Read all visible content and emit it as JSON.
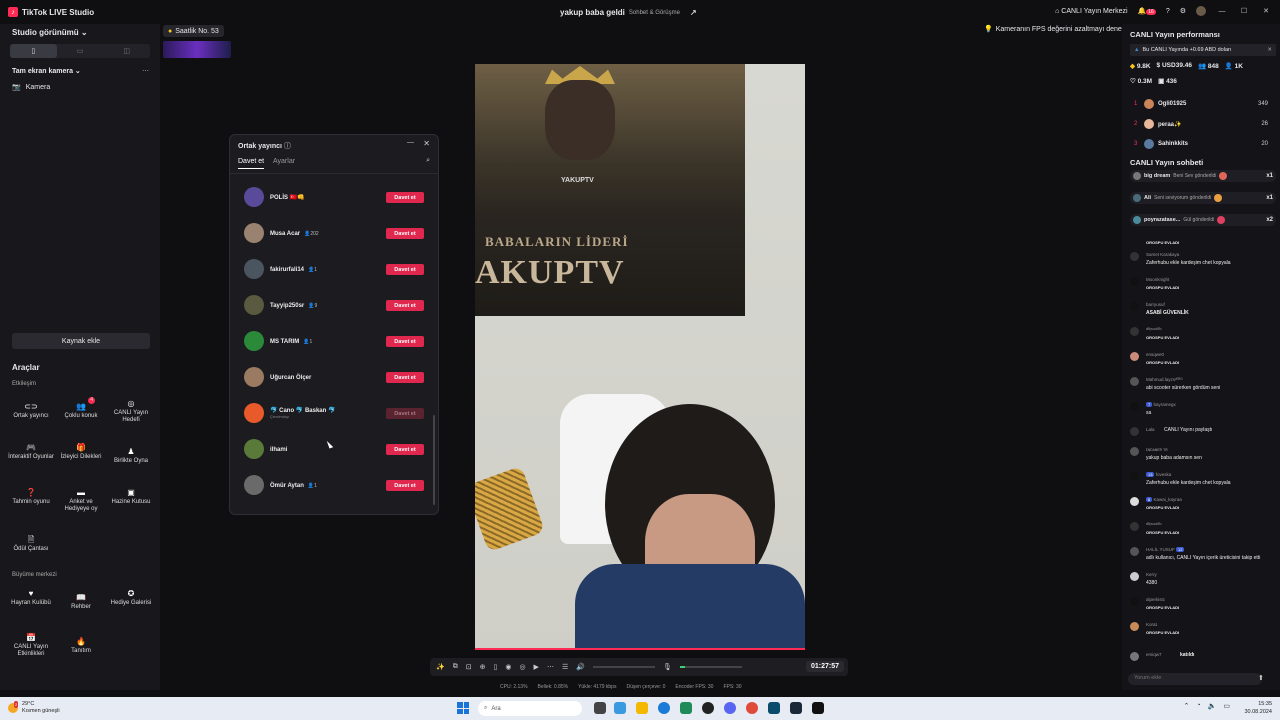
{
  "titlebar": {
    "app_name": "TikTok LIVE Studio",
    "stream_title": "yakup baba geldi",
    "category": "Sohbet & Görüşme",
    "live_center": "CANLI Yayın Merkezi",
    "notif_count": "16"
  },
  "left": {
    "studio_view": "Studio görünümü",
    "scene_name": "Tam ekran kamera",
    "source_camera": "Kamera",
    "add_source": "Kaynak ekle",
    "tools_title": "Araçlar",
    "engagement": "Etkileşim",
    "growth": "Büyüme merkezi",
    "tools": [
      {
        "label": "Ortak yayıncı",
        "icon": "co-host-icon"
      },
      {
        "label": "Çoklu konuk",
        "icon": "multi-guest-icon",
        "badge": "4"
      },
      {
        "label": "CANLI Yayın Hedefi",
        "icon": "live-goal-icon"
      },
      {
        "label": "İnteraktif Oyunlar",
        "icon": "games-icon"
      },
      {
        "label": "İzleyici Dilekleri",
        "icon": "wishes-icon"
      },
      {
        "label": "Birlikte Oyna",
        "icon": "play-together-icon"
      },
      {
        "label": "Tahmin oyunu",
        "icon": "guess-icon"
      },
      {
        "label": "Anket ve Hediyeye oy",
        "icon": "poll-icon"
      },
      {
        "label": "Hazine Kutusu",
        "icon": "treasure-icon"
      },
      {
        "label": "Ödül Çantası",
        "icon": "reward-bag-icon"
      }
    ],
    "growth_tools": [
      {
        "label": "Hayran Kulübü",
        "icon": "fan-club-icon"
      },
      {
        "label": "Rehber",
        "icon": "guide-icon"
      },
      {
        "label": "Hediye Galerisi",
        "icon": "gift-gallery-icon"
      },
      {
        "label": "CANLI Yayın Etkinlikleri",
        "icon": "events-icon"
      },
      {
        "label": "Tanıtım",
        "icon": "promote-icon"
      }
    ]
  },
  "stage": {
    "rank_tag": "Saatlik No. 53",
    "fps_tip": "Kameranın FPS değerini azaltmayı deneyin",
    "poster_line1": "BABALARIN LİDERİ",
    "poster_line2": "AKUPTV",
    "poster_small": "YAKUPTV"
  },
  "controls": {
    "timer": "01:27:57",
    "status": [
      "CPU: 2.13%",
      "Bellek: 0.85%",
      "Yükle: 4179 kbps",
      "Düşen çerçeve: 0",
      "Encoder FPS: 30",
      "FPS: 30"
    ]
  },
  "dialog": {
    "title": "Ortak yayıncı",
    "tab_invite": "Davet et",
    "tab_settings": "Ayarlar",
    "invite_label": "Davet et",
    "users": [
      {
        "name": "POLİS 🇹🇷👊",
        "count": "",
        "sub": "",
        "disabled": false,
        "color": "#5a4a9a"
      },
      {
        "name": "Musa Acar",
        "count": "👤202",
        "sub": "",
        "disabled": false,
        "color": "#9a8270"
      },
      {
        "name": "fakirurfali14",
        "count": "👤1",
        "sub": "",
        "disabled": false,
        "color": "#4a5560"
      },
      {
        "name": "Tayyip250sr",
        "count": "👤9",
        "sub": "",
        "disabled": false,
        "color": "#5a5a40"
      },
      {
        "name": "MS TARIM",
        "count": "👤1",
        "sub": "",
        "disabled": false,
        "color": "#2a8a3a"
      },
      {
        "name": "Uğurcan Ölçer",
        "count": "",
        "sub": "",
        "disabled": false,
        "color": "#9a7a60"
      },
      {
        "name": "🐬 Cano 🐬 Baskan 🐬",
        "count": "",
        "sub": "Çevrimdışı",
        "disabled": true,
        "color": "#e85a2a"
      },
      {
        "name": "ilhami",
        "count": "",
        "sub": "",
        "disabled": false,
        "color": "#5a7a3a"
      },
      {
        "name": "Ömür Aytan",
        "count": "👤1",
        "sub": "",
        "disabled": false,
        "color": "#6a6a6a"
      }
    ]
  },
  "right": {
    "perf_title": "CANLI Yayın performansı",
    "perf_note": "Bu CANLI Yayında +0.69 ABD doları",
    "stats": [
      "9.8K",
      "USD39.46",
      "848",
      "1K"
    ],
    "stats2": [
      "0.3M",
      "436"
    ],
    "ranking": [
      {
        "n": "1",
        "name": "Ogli01925",
        "v": "349"
      },
      {
        "n": "2",
        "name": "peraa✨",
        "v": "26"
      },
      {
        "n": "3",
        "name": "Sahinkkits",
        "v": "20"
      }
    ],
    "chat_title": "CANLI Yayın sohbeti",
    "gifts": [
      {
        "user": "big dream",
        "msg": "Beni Sev gönderildi",
        "mult": "x1"
      },
      {
        "user": "Ali",
        "msg": "Seni seviyorum gönderildi",
        "mult": "x1"
      },
      {
        "user": "poyrazatase...",
        "msg": "Gül gönderildi",
        "mult": "x2"
      }
    ],
    "chat": [
      {
        "name": "",
        "msg": "OROSPU EVLADI",
        "bold": true,
        "lvl": ""
      },
      {
        "name": "Samet Karakaya",
        "msg": "Zaferhubu ekle kardeşim chet kopyala",
        "bold": false,
        "lvl": ""
      },
      {
        "name": "Moonknight",
        "msg": "OROSPU EVLADI",
        "bold": true,
        "lvl": ""
      },
      {
        "name": "barryusuf",
        "msg": "ASABİ GÜVENLİK",
        "bold": false,
        "lvl": ""
      },
      {
        "name": "ˣᴮᴵʸᵘᵃʳᴬᴿˣ",
        "msg": "OROSPU EVLADI",
        "bold": true,
        "lvl": ""
      },
      {
        "name": "ensqwe0",
        "msg": "OROSPU EVLADI",
        "bold": true,
        "lvl": ""
      },
      {
        "name": "Mahmud.layzsᵞᴱᴿᴳ",
        "msg": "abi scooter sürerken gördüm seni",
        "bold": false,
        "lvl": ""
      },
      {
        "name": "bayramegx",
        "msg": "sa",
        "bold": false,
        "lvl": "7"
      },
      {
        "name": "Lala",
        "msg": "CANLI Yayını paylaştı",
        "bold": false,
        "lvl": ""
      },
      {
        "name": "ɪɴᴅᴀɴᴇʀ ᴛʀ",
        "msg": "yakup baba adamsın sen",
        "bold": false,
        "lvl": ""
      },
      {
        "name": "foveska",
        "msg": "Zaferhubu ekle kardeşim chet kopyala",
        "bold": false,
        "lvl": "13"
      },
      {
        "name": "Kawai_kayraa",
        "msg": "OROSPU EVLADI",
        "bold": true,
        "lvl": "6"
      },
      {
        "name": "ˣᴮᴵʸᵘᵃʳᴬᴿˣ",
        "msg": "OROSPU EVLADI",
        "bold": true,
        "lvl": ""
      },
      {
        "name": "HALİL YUSUF",
        "msg": "adlı kullanıcı, CANLI Yayın içerik üreticisini takip etti",
        "bold": false,
        "lvl": "12"
      },
      {
        "name": "Kerry",
        "msg": "4380",
        "bold": false,
        "lvl": ""
      },
      {
        "name": "alperkistc",
        "msg": "OROSPU EVLADI",
        "bold": true,
        "lvl": ""
      },
      {
        "name": "Koraɪ",
        "msg": "OROSPU EVLADI",
        "bold": true,
        "lvl": ""
      },
      {
        "name": "emiqw7",
        "msg": "katıldı",
        "bold": false,
        "lvl": ""
      }
    ],
    "chat_placeholder": "Yorum ekle"
  },
  "taskbar": {
    "temp": "29°C",
    "weather": "Kısmen güneşli",
    "weather_badge": "2",
    "search": "Ara",
    "time": "15:35",
    "date": "30.08.2024"
  }
}
